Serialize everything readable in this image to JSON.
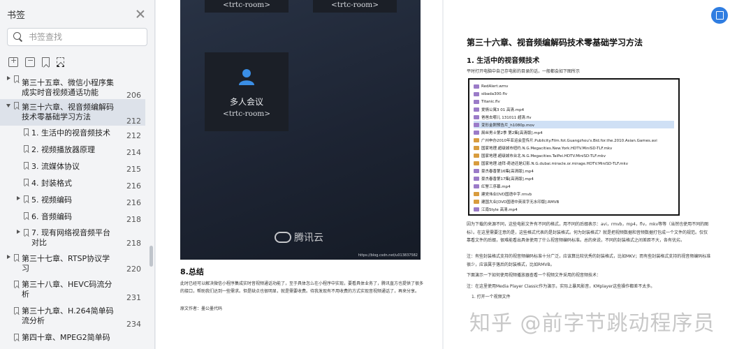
{
  "sidebar": {
    "title": "书签",
    "search_placeholder": "书签查找",
    "items": [
      {
        "label1": "第三十五章、微信小程序集",
        "label2": "成实时音视频通话功能",
        "page": "206"
      },
      {
        "label1": "第三十六章、视音频编解码",
        "label2": "技术零基础学习方法",
        "page": "212"
      },
      {
        "label1": "1. 生活中的视音频技术",
        "page": "212"
      },
      {
        "label1": "2. 视频播放器原理",
        "page": "214"
      },
      {
        "label1": "3. 流媒体协议",
        "page": "215"
      },
      {
        "label1": "4. 封装格式",
        "page": "216"
      },
      {
        "label1": "5. 视频编码",
        "page": "216"
      },
      {
        "label1": "6. 音频编码",
        "page": "218"
      },
      {
        "label1": "7. 现有网络视音频平台",
        "label2": "对比",
        "page": "218"
      },
      {
        "label1": "第三十七章、RTSP协议学",
        "label2": "习",
        "page": "220"
      },
      {
        "label1": "第三十八章、HEVC码流分",
        "label2": "析",
        "page": "231"
      },
      {
        "label1": "第三十九章、H.264简单码",
        "label2": "流分析",
        "page": "234"
      },
      {
        "label1": "第四十章、MPEG2简单码",
        "label2": "",
        "page": ""
      }
    ]
  },
  "left_page": {
    "video": {
      "room_label": "<trtc-room>",
      "tile_name": "多人会议",
      "watermark": "腾讯云",
      "credit": "https://blog.csdn.net/u013837582"
    },
    "section_title": "8.总结",
    "para1": "此时已经可以解决微信小程序集成实时音视频通话功能了，至于具体怎么在小程序中实现，要看具体业务了，腾讯直方也提供了很多的接口，帮助我们达到一些需求。但是缺点也很明显，就是需要收费。待我发现有不用收费的方式实现音视频通话了，再来分享。",
    "para2": "原文作者：墨公墨代码"
  },
  "right_page": {
    "h1": "第三十六章、视音频编解码技术零基础学习方法",
    "h2": "1. 生活中的视音频技术",
    "intro": "平时打开电脑中自己存电影的目录的话，一般都会如下图所示",
    "files": [
      {
        "name": "RedAlert.wmv",
        "kind": "v"
      },
      {
        "name": "sibada300.flv",
        "kind": "v"
      },
      {
        "name": "Titanic.flv",
        "kind": "v"
      },
      {
        "name": "爱情公寓3 01 高清.mp4",
        "kind": "v"
      },
      {
        "name": "爸爸去哪儿 131011 超清.flv",
        "kind": "v"
      },
      {
        "name": "变形金刚预告片_h1080p.mov",
        "kind": "v",
        "hl": true
      },
      {
        "name": "屌丝男士第2季 第2集[高清版].mp4",
        "kind": "v"
      },
      {
        "name": "广州申办2010年亚运会宣传片.Publicity.Film.fot.Guangzhou's.Bid.for.the.2010.Asian.Games.avi",
        "kind": "k"
      },
      {
        "name": "国家地理.超级城市纽约.N.G.Megacities.New.York.HDTV.MiniSD-TLF.mkv",
        "kind": "k"
      },
      {
        "name": "国家地理.超级城市台北.N.G.Megacities.TaiPei.HDTV.MiniSD-TLF.mkv",
        "kind": "k"
      },
      {
        "name": "国家地理.迪拜-奇迹还是幻影.N.G.dubai.miracle.or.mirage.HDTV.MiniSD-TLF.mkv",
        "kind": "k"
      },
      {
        "name": "豪杰春香第16集[高清版].mp4",
        "kind": "v"
      },
      {
        "name": "豪杰春香第17集[高清版].mp4",
        "kind": "v"
      },
      {
        "name": "红警三序幕.mp4",
        "kind": "v"
      },
      {
        "name": "建党伟业DVD国语中字.rmvb",
        "kind": "k"
      },
      {
        "name": "建国大业[DVD国语中英双字无水印版].RMVB",
        "kind": "k"
      },
      {
        "name": "江南Style 高清.mp4",
        "kind": "v"
      }
    ],
    "p1": "因为下载的来源不同，这些电影文件有不同的格式，用不同的后缀表示：avi，rmvb，mp4，flv，mkv等等（当然也使用不同的图标）。在这里需要注意的是，这些格式代表的是封装格式。何为封装格式？就是把视频数据和音频数据打包成一个文件的规范。仅仅靠看文件的后缀，很难能看出具体使用了什么视音频编码标准。总的来说，不同的封装格式之间差距不大，各有优劣。",
    "p2": "注：有些封装格式支持的视音频编码标准十分广泛，应该算比较优秀的封装格式，比如MKV；而有些封装格式支持的视音频编码标准很少，应该属于落后的封装格式，比如RMVB。",
    "p3": "下面演示一下如何使用视频播放器查看一个视频文件采用的视音频技术：",
    "p4": "注：在这里使用Media Player Classic作为演示，实际上暴风影音，KMplayer这些操作都差不太多。",
    "p5": "1. 打开一个视频文件"
  },
  "zhihu_watermark": "知乎 @前字节跳动程序员"
}
